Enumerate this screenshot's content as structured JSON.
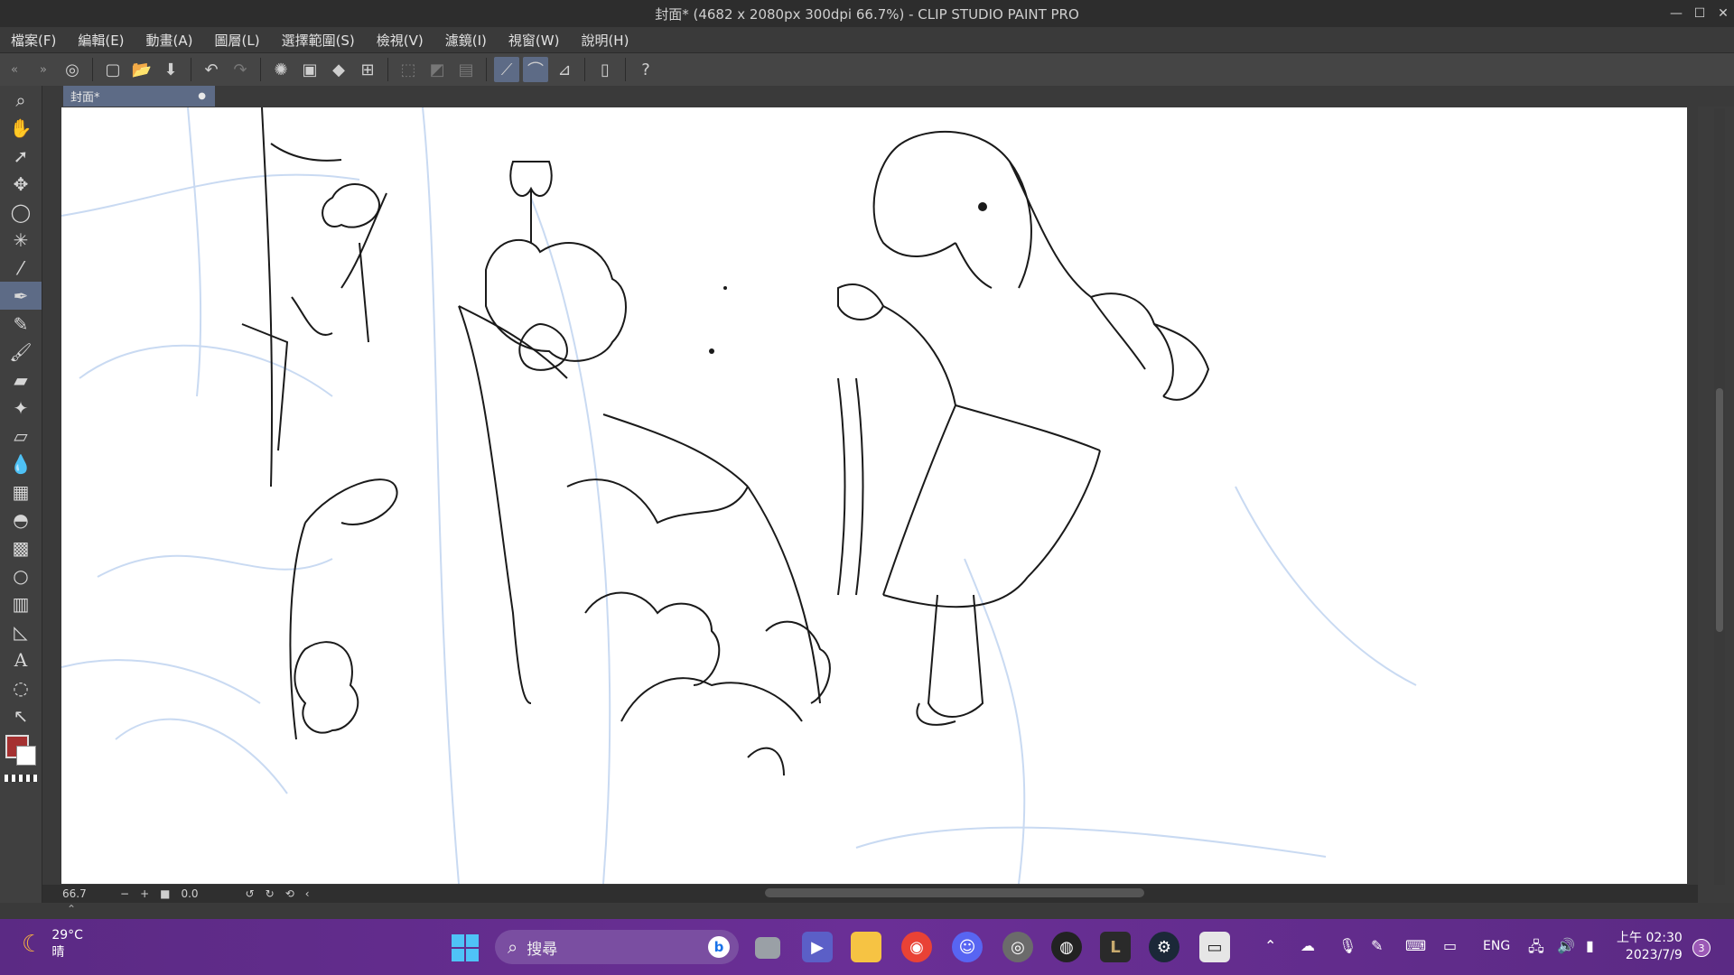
{
  "window": {
    "title": "封面* (4682 x 2080px 300dpi 66.7%)  - CLIP STUDIO PAINT PRO"
  },
  "menu": [
    "檔案(F)",
    "編輯(E)",
    "動畫(A)",
    "圖層(L)",
    "選擇範圍(S)",
    "檢視(V)",
    "濾鏡(I)",
    "視窗(W)",
    "說明(H)"
  ],
  "document": {
    "tab_label": "封面*"
  },
  "status": {
    "zoom": "66.7",
    "rotation": "0.0"
  },
  "colors": {
    "main": "#a53131",
    "sub": "#ffffff",
    "accent": "#5d6b86"
  },
  "taskbar": {
    "weather_temp": "29°C",
    "weather_desc": "晴",
    "search_placeholder": "搜尋",
    "lang": "ENG",
    "time": "上午 02:30",
    "date": "2023/7/9",
    "notification_count": "3"
  }
}
